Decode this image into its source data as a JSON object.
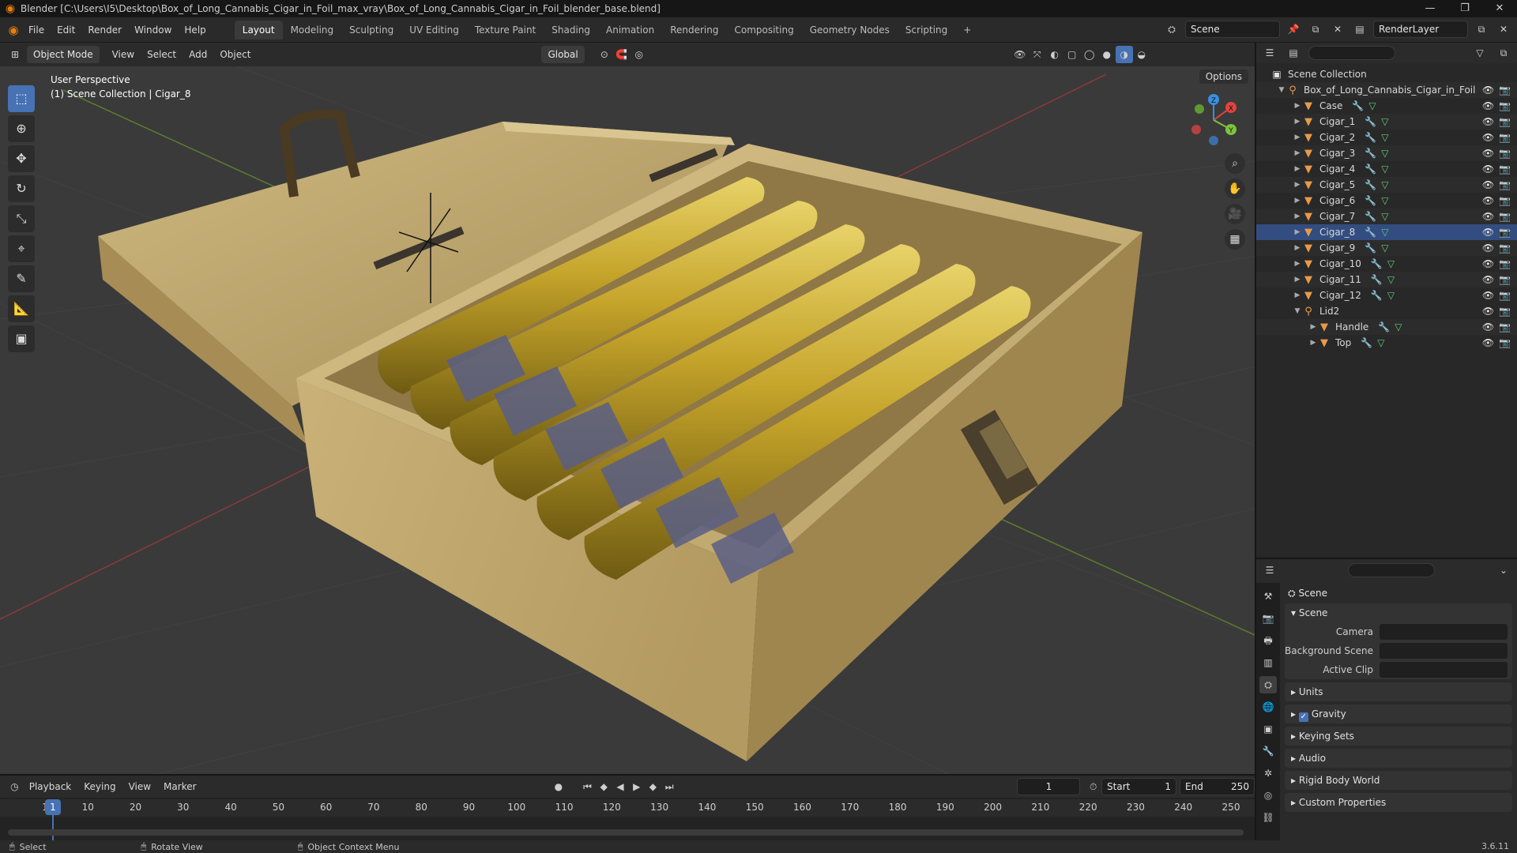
{
  "window": {
    "title": "Blender [C:\\Users\\I5\\Desktop\\Box_of_Long_Cannabis_Cigar_in_Foil_max_vray\\Box_of_Long_Cannabis_Cigar_in_Foil_blender_base.blend]",
    "minimize": "—",
    "maximize": "❐",
    "close": "✕"
  },
  "menu": [
    "File",
    "Edit",
    "Render",
    "Window",
    "Help"
  ],
  "workspaces": [
    "Layout",
    "Modeling",
    "Sculpting",
    "UV Editing",
    "Texture Paint",
    "Shading",
    "Animation",
    "Rendering",
    "Compositing",
    "Geometry Nodes",
    "Scripting",
    "+"
  ],
  "active_workspace": "Layout",
  "scene_field": "Scene",
  "renderlayer_field": "RenderLayer",
  "viewport_header": {
    "mode": "Object Mode",
    "menus": [
      "View",
      "Select",
      "Add",
      "Object"
    ],
    "transform": "Global",
    "options": "Options"
  },
  "viewport": {
    "perspective": "User Perspective",
    "context": "(1) Scene Collection | Cigar_8",
    "gizmo": {
      "x": "X",
      "y": "Y",
      "z": "Z"
    }
  },
  "outliner": {
    "scene_collection": "Scene Collection",
    "root": "Box_of_Long_Cannabis_Cigar_in_Foil",
    "items": [
      "Case",
      "Cigar_1",
      "Cigar_2",
      "Cigar_3",
      "Cigar_4",
      "Cigar_5",
      "Cigar_6",
      "Cigar_7",
      "Cigar_8",
      "Cigar_9",
      "Cigar_10",
      "Cigar_11",
      "Cigar_12"
    ],
    "group": "Lid2",
    "children": [
      "Handle",
      "Top"
    ]
  },
  "properties": {
    "title": "Scene",
    "panel": "Scene",
    "camera_label": "Camera",
    "bg_label": "Background Scene",
    "clip_label": "Active Clip",
    "sections": [
      "Units",
      "Gravity",
      "Keying Sets",
      "Audio",
      "Rigid Body World",
      "Custom Properties"
    ]
  },
  "timeline": {
    "menus": [
      "Playback",
      "Keying",
      "View",
      "Marker"
    ],
    "current_frame": "1",
    "start_label": "Start",
    "start": "1",
    "end_label": "End",
    "end": "250",
    "ticks": [
      "1",
      "10",
      "20",
      "30",
      "40",
      "50",
      "60",
      "70",
      "80",
      "90",
      "100",
      "110",
      "120",
      "130",
      "140",
      "150",
      "160",
      "170",
      "180",
      "190",
      "200",
      "210",
      "220",
      "230",
      "240",
      "250"
    ]
  },
  "status": {
    "select": "Select",
    "rotate": "Rotate View",
    "context_menu": "Object Context Menu",
    "version": "3.6.11"
  }
}
